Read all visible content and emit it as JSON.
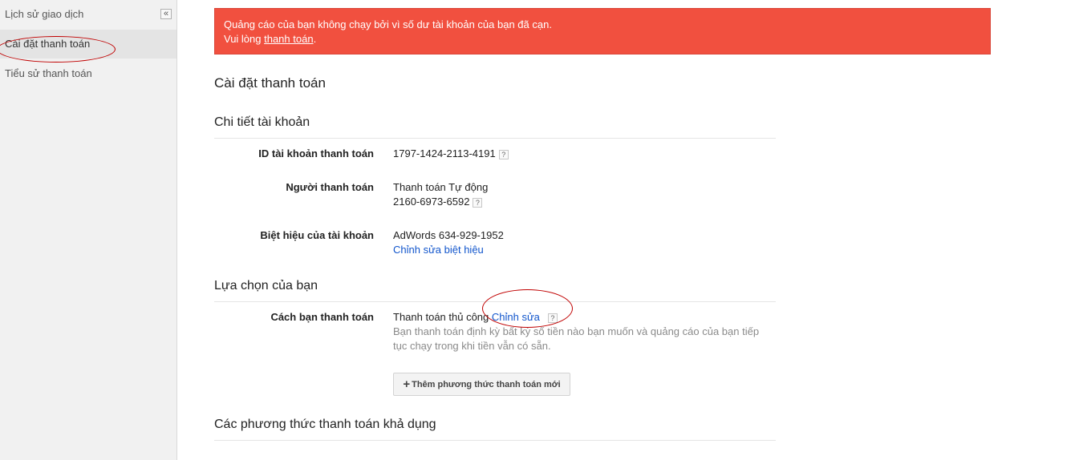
{
  "sidebar": {
    "items": [
      {
        "label": "Lịch sử giao dịch"
      },
      {
        "label": "Cài đặt thanh toán"
      },
      {
        "label": "Tiểu sử thanh toán"
      }
    ],
    "collapse_glyph": "«"
  },
  "alert": {
    "line1": "Quảng cáo của bạn không chạy bởi vì số dư tài khoản của bạn đã cạn.",
    "line2_prefix": "Vui lòng ",
    "line2_link": "thanh toán",
    "line2_suffix": "."
  },
  "page_title": "Cài đặt thanh toán",
  "account_details": {
    "title": "Chi tiết tài khoản",
    "rows": [
      {
        "label": "ID tài khoản thanh toán",
        "value": "1797-1424-2113-4191"
      },
      {
        "label": "Người thanh toán",
        "value": "Thanh toán Tự động",
        "value2": "2160-6973-6592"
      },
      {
        "label": "Biệt hiệu của tài khoản",
        "value": "AdWords 634-929-1952",
        "link": "Chỉnh sửa biệt hiệu"
      }
    ]
  },
  "your_choice": {
    "title": "Lựa chọn của bạn",
    "label": "Cách bạn thanh toán",
    "value": "Thanh toán thủ công",
    "edit_link": "Chỉnh sửa",
    "description": "Bạn thanh toán định kỳ bất kỳ số tiền nào bạn muốn và quảng cáo của bạn tiếp tục chạy trong khi tiền vẫn có sẵn.",
    "add_button": "Thêm phương thức thanh toán mới",
    "add_button_icon": "+"
  },
  "available_methods": {
    "title": "Các phương thức thanh toán khả dụng"
  },
  "help_glyph": "?",
  "colors": {
    "alert_bg": "#f1503f",
    "link": "#1155cc",
    "annotation_ellipse": "#c00000"
  }
}
